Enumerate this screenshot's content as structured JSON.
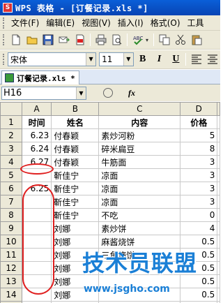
{
  "window": {
    "title": "WPS 表格 - [订餐记录.xls *]",
    "app_badge": "S"
  },
  "menu": [
    "文件(F)",
    "编辑(E)",
    "视图(V)",
    "插入(I)",
    "格式(O)",
    "工具"
  ],
  "format": {
    "font_name": "宋体",
    "font_size": "11",
    "bold": "B",
    "italic": "I",
    "underline": "U"
  },
  "doc_tab": {
    "label": "订餐记录.xls *"
  },
  "formula_bar": {
    "cell_ref": "H16",
    "fx": "fx"
  },
  "sheet": {
    "columns": [
      "A",
      "B",
      "C",
      "D"
    ],
    "rows": [
      {
        "n": "1",
        "a": "时间",
        "b": "姓名",
        "c": "内容",
        "d": "价格"
      },
      {
        "n": "2",
        "a": "6.23",
        "b": "付春颖",
        "c": "素炒河粉",
        "d": "5"
      },
      {
        "n": "3",
        "a": "6.24",
        "b": "付春颖",
        "c": "碎米扁豆",
        "d": "8"
      },
      {
        "n": "4",
        "a": "6.27",
        "b": "付春颖",
        "c": "牛筋面",
        "d": "3"
      },
      {
        "n": "5",
        "a": "",
        "b": "靳佳宁",
        "c": "凉面",
        "d": "3"
      },
      {
        "n": "6",
        "a": "6.25",
        "b": "靳佳宁",
        "c": "凉面",
        "d": "3"
      },
      {
        "n": "7",
        "a": "",
        "b": "靳佳宁",
        "c": "凉面",
        "d": "3"
      },
      {
        "n": "8",
        "a": "",
        "b": "靳佳宁",
        "c": "不吃",
        "d": "0"
      },
      {
        "n": "9",
        "a": "",
        "b": "刘娜",
        "c": "素炒饼",
        "d": "4"
      },
      {
        "n": "10",
        "a": "",
        "b": "刘娜",
        "c": "麻酱烧饼",
        "d": "0.5"
      },
      {
        "n": "11",
        "a": "",
        "b": "刘娜",
        "c": "三角烧饼",
        "d": "0.5"
      },
      {
        "n": "12",
        "a": "",
        "b": "刘娜",
        "c": "",
        "d": "0.5"
      },
      {
        "n": "13",
        "a": "",
        "b": "刘娜",
        "c": "",
        "d": "0.5"
      },
      {
        "n": "14",
        "a": "",
        "b": "刘娜",
        "c": "",
        "d": "0.5"
      },
      {
        "n": "15",
        "a": "",
        "b": "刘娜",
        "c": "",
        "d": "0.7"
      }
    ]
  },
  "watermark": {
    "big": "技术员联盟",
    "small": "www.jsgho.com"
  },
  "colors": {
    "title_bar": "#0a5fd8",
    "annotation": "#e02020",
    "watermark": "#1a7fd6"
  }
}
